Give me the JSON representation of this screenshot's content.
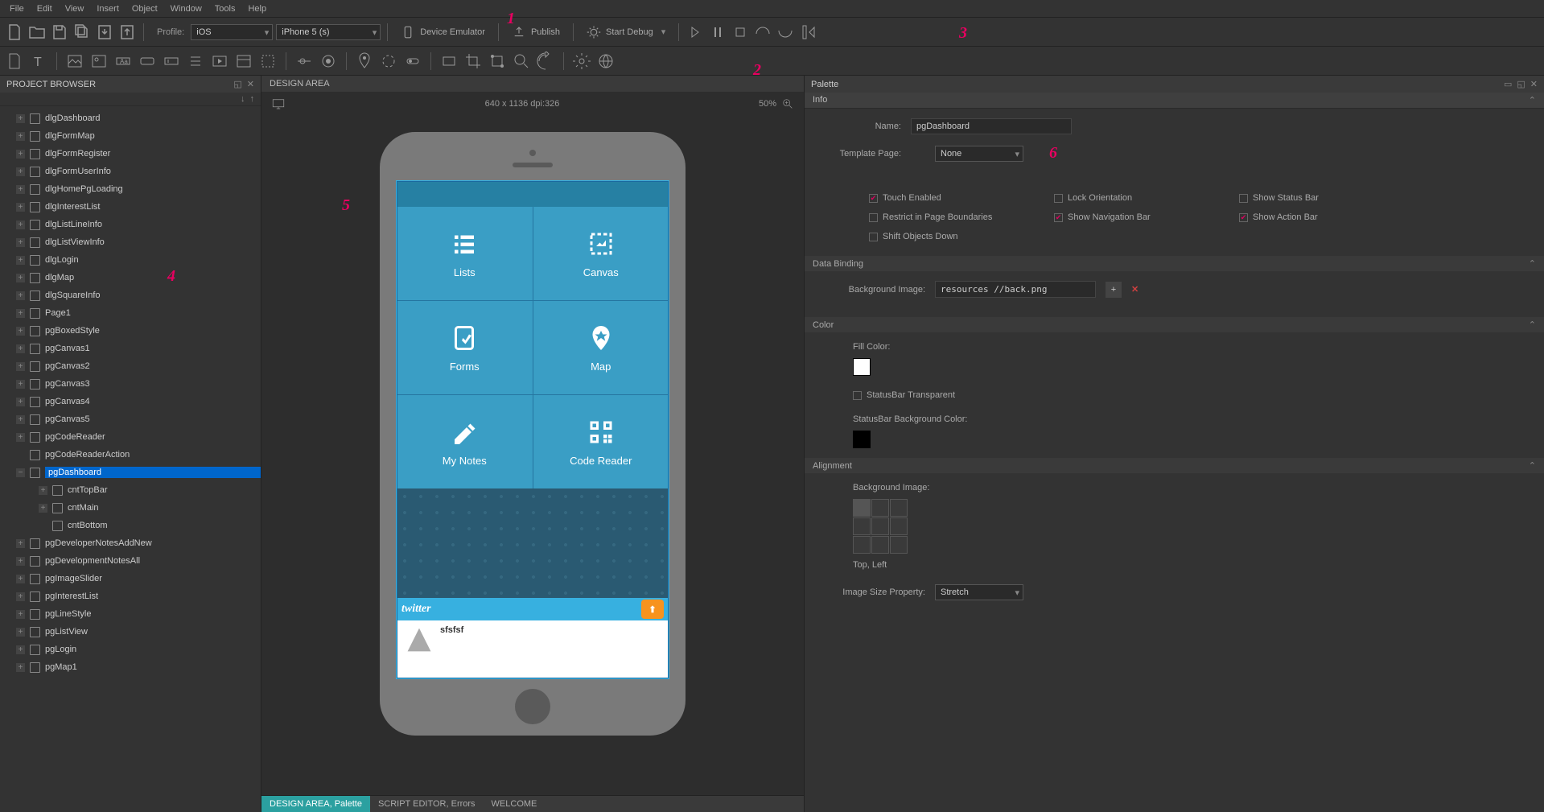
{
  "menubar": [
    "File",
    "Edit",
    "View",
    "Insert",
    "Object",
    "Window",
    "Tools",
    "Help"
  ],
  "toolbar1": {
    "profile_label": "Profile:",
    "platform": "iOS",
    "device": "iPhone 5 (s)",
    "device_emulator": "Device Emulator",
    "publish": "Publish",
    "start_debug": "Start Debug"
  },
  "project_browser": {
    "title": "PROJECT BROWSER",
    "items": [
      {
        "label": "dlgDashboard",
        "exp": true
      },
      {
        "label": "dlgFormMap",
        "exp": true
      },
      {
        "label": "dlgFormRegister",
        "exp": true
      },
      {
        "label": "dlgFormUserInfo",
        "exp": true
      },
      {
        "label": "dlgHomePgLoading",
        "exp": true
      },
      {
        "label": "dlgInterestList",
        "exp": true
      },
      {
        "label": "dlgListLineInfo",
        "exp": true
      },
      {
        "label": "dlgListViewInfo",
        "exp": true
      },
      {
        "label": "dlgLogin",
        "exp": true
      },
      {
        "label": "dlgMap",
        "exp": true
      },
      {
        "label": "dlgSquareInfo",
        "exp": true
      },
      {
        "label": "Page1",
        "exp": true
      },
      {
        "label": "pgBoxedStyle",
        "exp": true
      },
      {
        "label": "pgCanvas1",
        "exp": true
      },
      {
        "label": "pgCanvas2",
        "exp": true
      },
      {
        "label": "pgCanvas3",
        "exp": true
      },
      {
        "label": "pgCanvas4",
        "exp": true
      },
      {
        "label": "pgCanvas5",
        "exp": true
      },
      {
        "label": "pgCodeReader",
        "exp": true
      },
      {
        "label": "pgCodeReaderAction",
        "exp": false,
        "leaf": true
      },
      {
        "label": "pgDashboard",
        "exp": true,
        "expanded": true,
        "selected": true
      },
      {
        "label": "cntTopBar",
        "exp": true,
        "child": true
      },
      {
        "label": "cntMain",
        "exp": true,
        "child": true
      },
      {
        "label": "cntBottom",
        "exp": false,
        "child": true,
        "leaf": true
      },
      {
        "label": "pgDeveloperNotesAddNew",
        "exp": true
      },
      {
        "label": "pgDevelopmentNotesAll",
        "exp": true
      },
      {
        "label": "pgImageSlider",
        "exp": true
      },
      {
        "label": "pgInterestList",
        "exp": true
      },
      {
        "label": "pgLineStyle",
        "exp": true
      },
      {
        "label": "pgListView",
        "exp": true
      },
      {
        "label": "pgLogin",
        "exp": true
      },
      {
        "label": "pgMap1",
        "exp": true
      }
    ]
  },
  "design_area": {
    "title": "DESIGN AREA",
    "dimensions": "640 x 1136 dpi:326",
    "zoom": "50%",
    "tiles": [
      {
        "label": "Lists"
      },
      {
        "label": "Canvas"
      },
      {
        "label": "Forms"
      },
      {
        "label": "Map"
      },
      {
        "label": "My Notes"
      },
      {
        "label": "Code Reader"
      }
    ],
    "twitter": "twitter",
    "feed_name": "sfsfsf"
  },
  "bottom_tabs": [
    {
      "label": "DESIGN AREA, Palette",
      "active": true
    },
    {
      "label": "SCRIPT EDITOR, Errors",
      "active": false
    },
    {
      "label": "WELCOME",
      "active": false
    }
  ],
  "palette": {
    "title": "Palette",
    "info_tab": "Info",
    "name_label": "Name:",
    "name_value": "pgDashboard",
    "template_label": "Template Page:",
    "template_value": "None",
    "checks": {
      "touch_enabled": "Touch Enabled",
      "lock_orientation": "Lock Orientation",
      "show_status_bar": "Show Status Bar",
      "restrict": "Restrict in Page Boundaries",
      "show_nav": "Show Navigation Bar",
      "show_action": "Show Action Bar",
      "shift": "Shift Objects Down"
    },
    "data_binding": "Data Binding",
    "bg_image_label": "Background Image:",
    "bg_image_value": "resources //back.png",
    "color_head": "Color",
    "fill_color": "Fill Color:",
    "statusbar_transparent": "StatusBar Transparent",
    "statusbar_bg": "StatusBar Background Color:",
    "alignment_head": "Alignment",
    "alignment_bg": "Background Image:",
    "alignment_pos": "Top, Left",
    "imgsize_label": "Image Size Property:",
    "imgsize_value": "Stretch"
  },
  "annotations": {
    "a1": "1",
    "a2": "2",
    "a3": "3",
    "a4": "4",
    "a5": "5",
    "a6": "6"
  }
}
